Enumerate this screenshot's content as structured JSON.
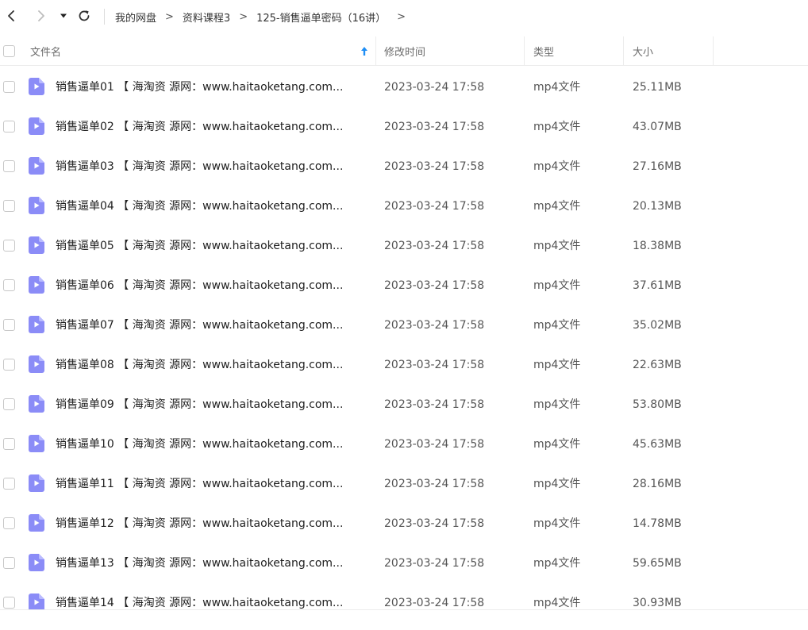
{
  "toolbar": {
    "back_icon": "chevron-left-icon",
    "forward_icon": "chevron-right-icon",
    "dropdown_icon": "caret-down-icon",
    "refresh_icon": "refresh-icon"
  },
  "breadcrumb": {
    "items": [
      "我的网盘",
      "资料课程3",
      "125-销售逼单密码（16讲）"
    ],
    "separator": ">"
  },
  "columns": {
    "name": "文件名",
    "modified": "修改时间",
    "type": "类型",
    "size": "大小",
    "sort_icon": "sort-arrow-up-icon"
  },
  "colors": {
    "accent": "#1e8ef5",
    "file_icon": "#8b8cf7"
  },
  "files": [
    {
      "name": "销售逼单01 【 海淘资 源网：www.haitaoketang.com...",
      "modified": "2023-03-24 17:58",
      "type": "mp4文件",
      "size": "25.11MB"
    },
    {
      "name": "销售逼单02 【 海淘资 源网：www.haitaoketang.com...",
      "modified": "2023-03-24 17:58",
      "type": "mp4文件",
      "size": "43.07MB"
    },
    {
      "name": "销售逼单03 【 海淘资 源网：www.haitaoketang.com...",
      "modified": "2023-03-24 17:58",
      "type": "mp4文件",
      "size": "27.16MB"
    },
    {
      "name": "销售逼单04 【 海淘资 源网：www.haitaoketang.com...",
      "modified": "2023-03-24 17:58",
      "type": "mp4文件",
      "size": "20.13MB"
    },
    {
      "name": "销售逼单05 【 海淘资 源网：www.haitaoketang.com...",
      "modified": "2023-03-24 17:58",
      "type": "mp4文件",
      "size": "18.38MB"
    },
    {
      "name": "销售逼单06 【 海淘资 源网：www.haitaoketang.com...",
      "modified": "2023-03-24 17:58",
      "type": "mp4文件",
      "size": "37.61MB"
    },
    {
      "name": "销售逼单07 【 海淘资 源网：www.haitaoketang.com...",
      "modified": "2023-03-24 17:58",
      "type": "mp4文件",
      "size": "35.02MB"
    },
    {
      "name": "销售逼单08 【 海淘资 源网：www.haitaoketang.com...",
      "modified": "2023-03-24 17:58",
      "type": "mp4文件",
      "size": "22.63MB"
    },
    {
      "name": "销售逼单09 【 海淘资 源网：www.haitaoketang.com...",
      "modified": "2023-03-24 17:58",
      "type": "mp4文件",
      "size": "53.80MB"
    },
    {
      "name": "销售逼单10 【 海淘资 源网：www.haitaoketang.com...",
      "modified": "2023-03-24 17:58",
      "type": "mp4文件",
      "size": "45.63MB"
    },
    {
      "name": "销售逼单11 【 海淘资 源网：www.haitaoketang.com...",
      "modified": "2023-03-24 17:58",
      "type": "mp4文件",
      "size": "28.16MB"
    },
    {
      "name": "销售逼单12 【 海淘资 源网：www.haitaoketang.com...",
      "modified": "2023-03-24 17:58",
      "type": "mp4文件",
      "size": "14.78MB"
    },
    {
      "name": "销售逼单13 【 海淘资 源网：www.haitaoketang.com...",
      "modified": "2023-03-24 17:58",
      "type": "mp4文件",
      "size": "59.65MB"
    },
    {
      "name": "销售逼单14 【 海淘资 源网：www.haitaoketang.com...",
      "modified": "2023-03-24 17:58",
      "type": "mp4文件",
      "size": "30.93MB"
    }
  ]
}
